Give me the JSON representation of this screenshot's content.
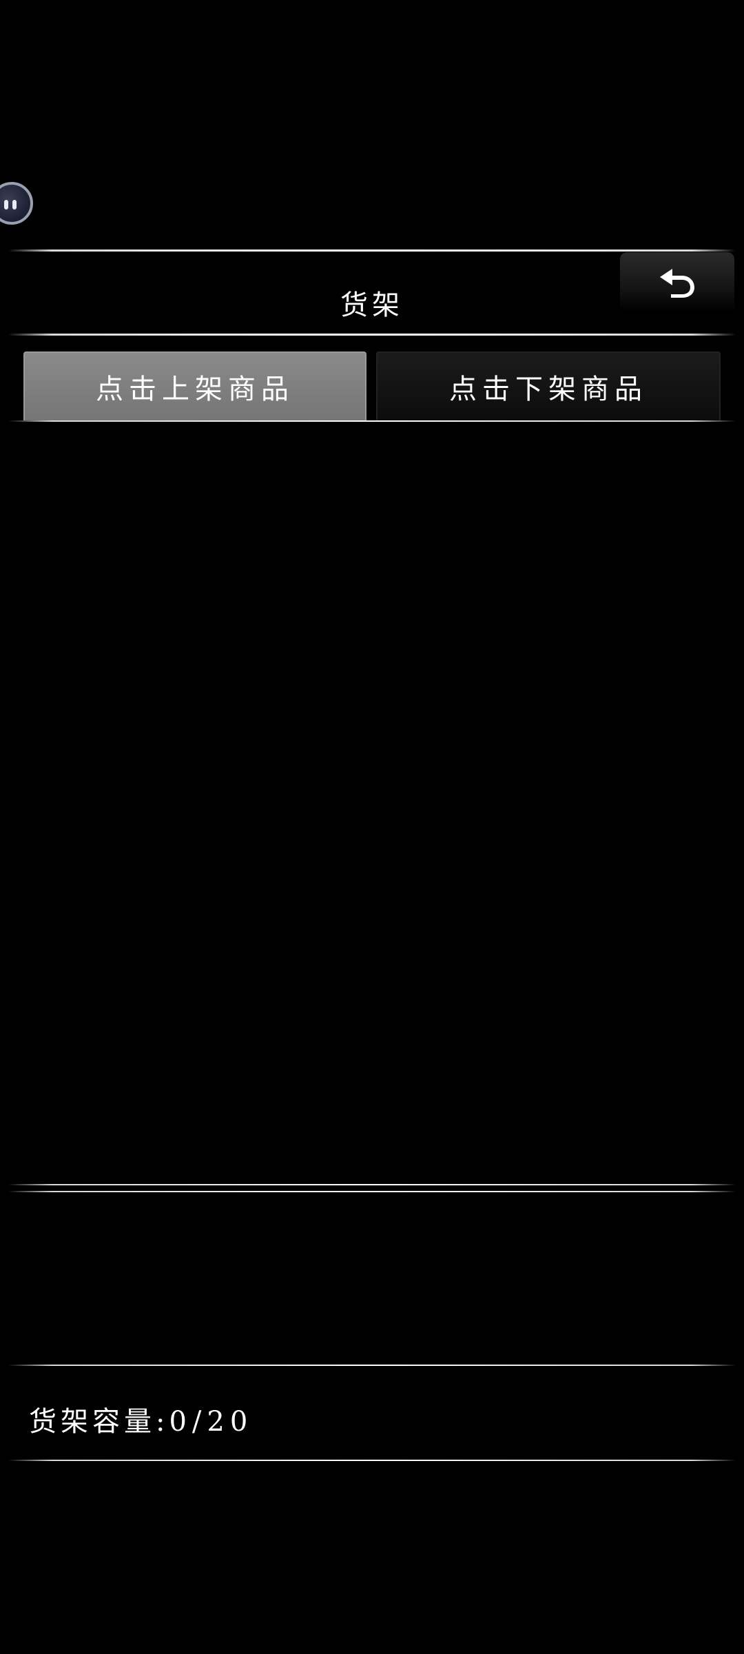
{
  "header": {
    "title": "货架",
    "back_icon": "back-arrow-icon"
  },
  "tabs": [
    {
      "label": "点击上架商品",
      "active": true
    },
    {
      "label": "点击下架商品",
      "active": false
    }
  ],
  "shelf": {
    "capacity_label": "货架容量:",
    "capacity_value": "0/20"
  },
  "floating_assistant": {
    "icon": "assistant-ball-icon"
  }
}
